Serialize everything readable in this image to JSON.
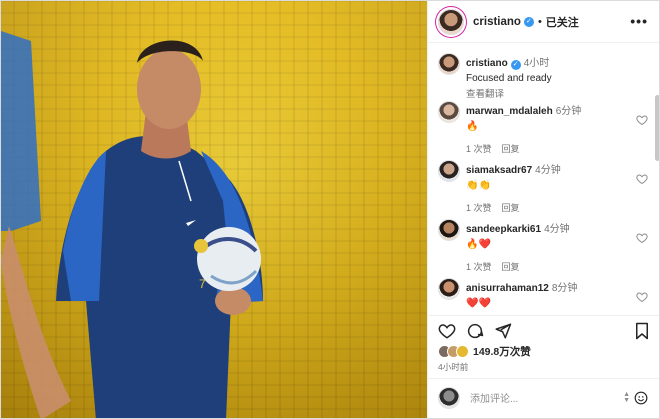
{
  "header": {
    "username": "cristiano",
    "dot": "•",
    "follow_label": "已关注",
    "more_label": "•••"
  },
  "caption": {
    "username": "cristiano",
    "time": "4小时",
    "text": "Focused and ready",
    "translate": "查看翻译"
  },
  "comments": [
    {
      "username": "marwan_mdalaleh",
      "time": "6分钟",
      "text": "🔥",
      "likes": "1 次赞",
      "reply": "回复"
    },
    {
      "username": "siamaksadr67",
      "time": "4分钟",
      "text": "👏👏",
      "likes": "1 次赞",
      "reply": "回复"
    },
    {
      "username": "sandeepkarki61",
      "time": "4分钟",
      "text": "🔥❤️",
      "likes": "1 次赞",
      "reply": "回复"
    },
    {
      "username": "anisurrahaman12",
      "time": "8分钟",
      "text": "❤️❤️",
      "likes": "",
      "reply": ""
    }
  ],
  "footer": {
    "likes_count": "149.8万次赞",
    "post_time": "4小时前",
    "add_comment_placeholder": "添加评论..."
  },
  "icons": {
    "like": "heart-icon",
    "comment": "comment-icon",
    "share": "send-icon",
    "save": "bookmark-icon",
    "emoji": "emoji-icon",
    "more": "more-icon"
  },
  "colors": {
    "verified": "#3897f0",
    "text": "#262626",
    "muted": "#737373"
  }
}
